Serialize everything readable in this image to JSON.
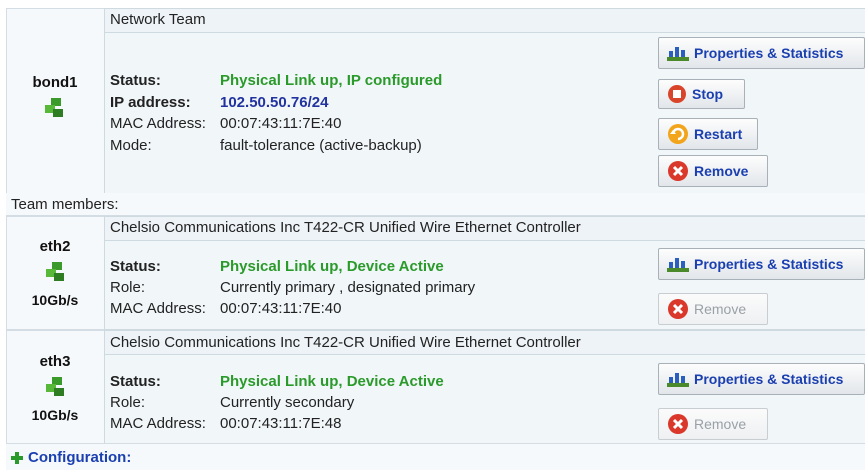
{
  "team": {
    "header": "Network Team",
    "name": "bond1",
    "status_label": "Status:",
    "status_value": "Physical Link up, IP configured",
    "ip_label": "IP address:",
    "ip_value": "102.50.50.76/24",
    "mac_label": "MAC Address:",
    "mac_value": "00:07:43:11:7E:40",
    "mode_label": "Mode:",
    "mode_value": "fault-tolerance (active-backup)",
    "buttons": {
      "properties": "Properties & Statistics",
      "stop": "Stop",
      "restart": "Restart",
      "remove": "Remove"
    }
  },
  "members_label": "Team members:",
  "members": [
    {
      "name": "eth2",
      "speed": "10Gb/s",
      "device": "Chelsio Communications Inc T422-CR Unified Wire Ethernet Controller",
      "status_label": "Status:",
      "status_value": "Physical Link up, Device Active",
      "role_label": "Role:",
      "role_value": "Currently primary , designated primary",
      "mac_label": "MAC Address:",
      "mac_value": "00:07:43:11:7E:40",
      "properties": "Properties & Statistics",
      "remove": "Remove"
    },
    {
      "name": "eth3",
      "speed": "10Gb/s",
      "device": "Chelsio Communications Inc T422-CR Unified Wire Ethernet Controller",
      "status_label": "Status:",
      "status_value": "Physical Link up, Device Active",
      "role_label": "Role:",
      "role_value": "Currently secondary",
      "mac_label": "MAC Address:",
      "mac_value": "00:07:43:11:7E:48",
      "properties": "Properties & Statistics",
      "remove": "Remove"
    }
  ],
  "configuration": {
    "expand_icon": "plus-icon",
    "label": "Configuration:"
  },
  "colors": {
    "status_ok": "#2a9a2a",
    "ip": "#2233a0",
    "link": "#1a3fb0"
  }
}
